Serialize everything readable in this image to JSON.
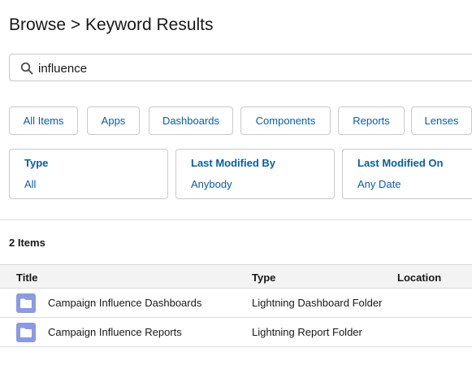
{
  "header": {
    "title": "Browse > Keyword Results"
  },
  "search": {
    "value": "influence",
    "icon": "search-icon"
  },
  "filter_tabs": [
    {
      "label": "All Items"
    },
    {
      "label": "Apps"
    },
    {
      "label": "Dashboards"
    },
    {
      "label": "Components"
    },
    {
      "label": "Reports"
    },
    {
      "label": "Lenses"
    }
  ],
  "facets": [
    {
      "title": "Type",
      "value": "All"
    },
    {
      "title": "Last Modified By",
      "value": "Anybody"
    },
    {
      "title": "Last Modified On",
      "value": "Any Date"
    }
  ],
  "results": {
    "count_label": "2 Items",
    "columns": [
      "Title",
      "Type",
      "Location"
    ],
    "rows": [
      {
        "title": "Campaign Influence Dashboards",
        "type": "Lightning Dashboard Folder",
        "location": "",
        "icon": "folder-icon"
      },
      {
        "title": "Campaign Influence Reports",
        "type": "Lightning Report Folder",
        "location": "",
        "icon": "folder-icon"
      }
    ]
  },
  "colors": {
    "link": "#0b5cab",
    "folder_icon_bg": "#8b9ae5",
    "border": "#c9c9c9",
    "header_bg": "#f3f3f3"
  }
}
